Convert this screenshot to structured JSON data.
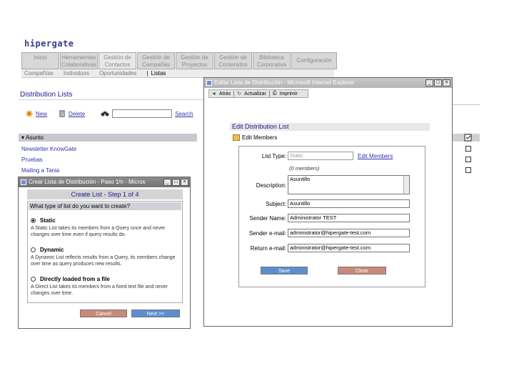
{
  "app": {
    "logo": "hipergate",
    "tabs": [
      {
        "line1": "Inicio",
        "line2": ""
      },
      {
        "line1": "Herramientas",
        "line2": "Colaborativas"
      },
      {
        "line1": "Gestión de",
        "line2": "Contactos"
      },
      {
        "line1": "Gestión de",
        "line2": "Campañas"
      },
      {
        "line1": "Gestión de",
        "line2": "Proyectos"
      },
      {
        "line1": "Gestión de",
        "line2": "Contenidos"
      },
      {
        "line1": "Biblioteca",
        "line2": "Corporativa"
      },
      {
        "line1": "Configuración",
        "line2": ""
      }
    ],
    "subnav": [
      "Compañías",
      "Individuos",
      "Oportunidades",
      "Listas"
    ],
    "subnav_sep": "|"
  },
  "main": {
    "title": "Distribution Lists",
    "new_label": "New",
    "delete_label": "Delete",
    "search_label": "Search",
    "column_header": "Asunto",
    "items": [
      "Newsletter KnowGate",
      "Pruebas",
      "Mailing a Tania"
    ]
  },
  "create_window": {
    "title": "Crear Lista de Distribución - Paso 1/n - Micros",
    "heading": "Create List - Step 1 of 4",
    "question": "What type of list do you want to create?",
    "options": [
      {
        "label": "Static",
        "desc": "A Static List takes its members from a Query once and never changes over time even if query results do."
      },
      {
        "label": "Dynamic",
        "desc": "A Dynamic List reflects results from a Query, its members change over time as query produces new results."
      },
      {
        "label": "Directly loaded from a file",
        "desc": "A Direct List takes its members from a fixed text file and never changes over time."
      }
    ],
    "cancel_label": "Cancel",
    "next_label": "Next >>"
  },
  "edit_window": {
    "title": "Editar Lista de Distribución - Microsoft Internet Explorer",
    "toolbar": {
      "back": "Atrás",
      "refresh": "Actualizar",
      "print": "Imprimir"
    },
    "heading": "Edit Distribution List",
    "edit_members_label": "Edit Members",
    "form": {
      "list_type_label": "List Type:",
      "list_type_value": "Static",
      "list_type_link": "Edit Members",
      "members_count": "(0 members)",
      "description_label": "Description:",
      "description_value": "Asuntillo",
      "subject_label": "Subject:",
      "subject_value": "Asuntillo",
      "sender_name_label": "Sender Name:",
      "sender_name_value": "Administrator TEST",
      "sender_email_label": "Sender e-mail:",
      "sender_email_value": "administrator@hipergate-test.com",
      "return_email_label": "Return e-mail:",
      "return_email_value": "administrator@hipergate-test.com"
    },
    "save_label": "Save",
    "close_label": "Close"
  },
  "colors": {
    "link": "#3333aa",
    "heading": "#1a1a8a",
    "button_blue": "#5b8fcf",
    "button_red": "#c98a7a"
  }
}
